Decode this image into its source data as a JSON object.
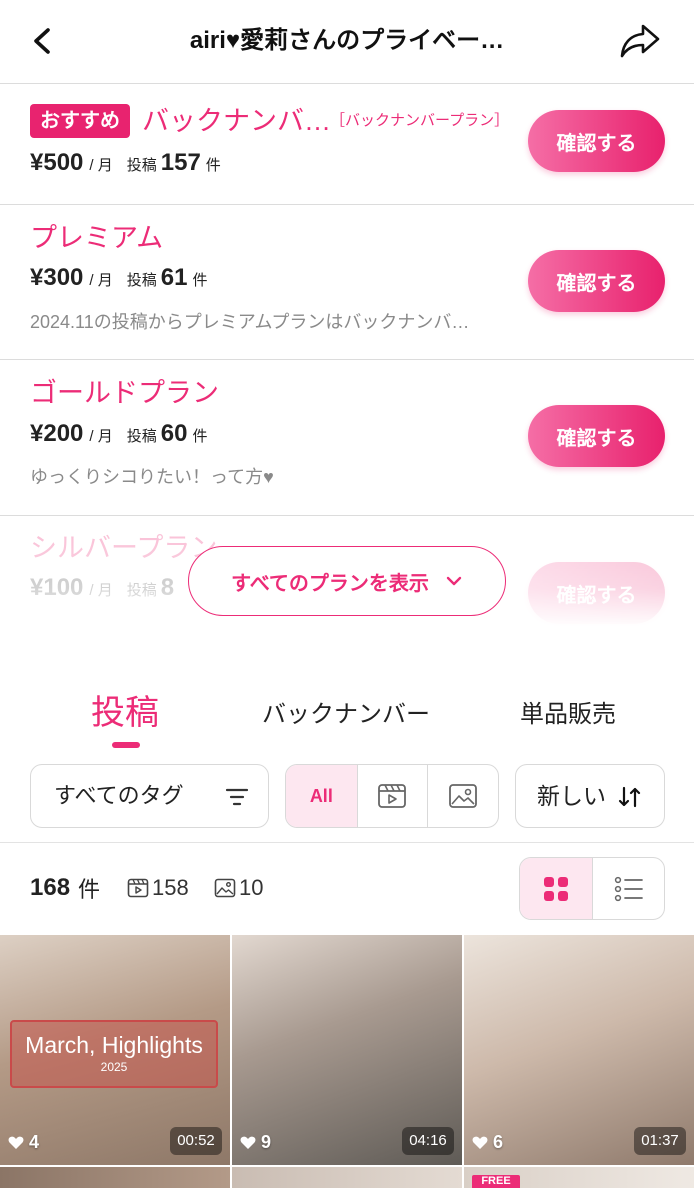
{
  "header": {
    "title": "airi♥愛莉さんのプライベー…"
  },
  "plans": [
    {
      "badge": "おすすめ",
      "name": "バックナンバ…",
      "tag": "［バックナンバープラン］",
      "price": "¥500",
      "per": "/ 月",
      "posts_label": "投稿",
      "posts": "157",
      "posts_unit": "件",
      "button": "確認する"
    },
    {
      "name": "プレミアム",
      "price": "¥300",
      "per": "/ 月",
      "posts_label": "投稿",
      "posts": "61",
      "posts_unit": "件",
      "description": "2024.11の投稿からプレミアムプランはバックナンバ…",
      "button": "確認する"
    },
    {
      "name": "ゴールドプラン",
      "price": "¥200",
      "per": "/ 月",
      "posts_label": "投稿",
      "posts": "60",
      "posts_unit": "件",
      "description": "ゆっくりシコりたい！って方♥",
      "button": "確認する"
    },
    {
      "name": "シルバープラン",
      "price": "¥100",
      "per": "/ 月",
      "posts_label": "投稿",
      "posts": "8",
      "button": "確認する"
    }
  ],
  "show_all_plans": {
    "label": "すべてのプランを表示"
  },
  "tabs": [
    {
      "label": "投稿",
      "active": true
    },
    {
      "label": "バックナンバー",
      "active": false
    },
    {
      "label": "単品販売",
      "active": false
    }
  ],
  "filters": {
    "tags_label": "すべてのタグ",
    "media_all_label": "All",
    "media_all_active": true,
    "sort_label": "新しい"
  },
  "summary": {
    "count": "168",
    "unit": "件",
    "video_count": "158",
    "image_count": "10",
    "grid_view_active": true
  },
  "posts": [
    {
      "title_overlay": "March, Highlights",
      "year_overlay": "2025",
      "likes": "4",
      "duration": "00:52"
    },
    {
      "likes": "9",
      "duration": "04:16"
    },
    {
      "likes": "6",
      "duration": "01:37"
    },
    {},
    {},
    {
      "badge": "FREE"
    }
  ],
  "colors": {
    "accent": "#ec2c77",
    "accent_light": "#fde7f0",
    "text": "#222222",
    "muted": "#8a8a8a",
    "divider": "#dcdcdc"
  }
}
